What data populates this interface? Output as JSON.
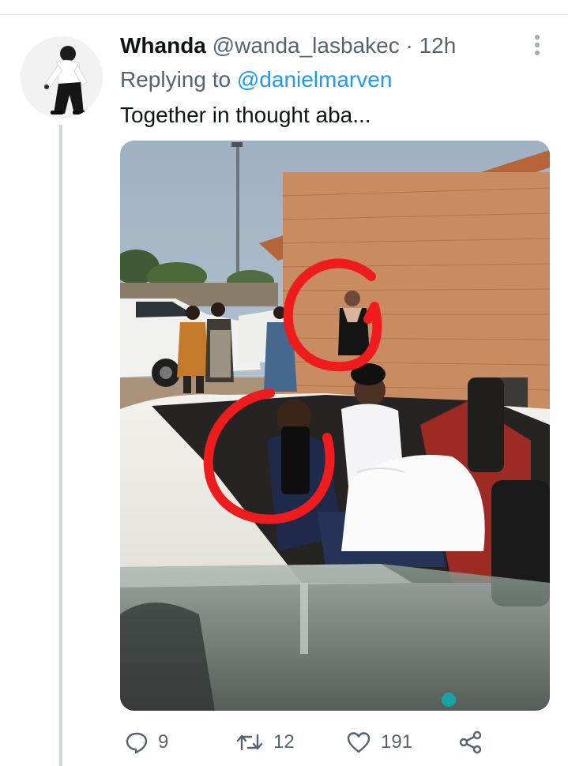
{
  "tweet": {
    "display_name": "Whanda",
    "handle": "@wanda_lasbakec",
    "separator": "·",
    "timestamp": "12h",
    "replying_prefix": "Replying to",
    "replying_to": "@danielmarven",
    "text": "Together in thought aba...",
    "more_icon": "more-vertical-icon"
  },
  "actions": {
    "reply_count": "9",
    "retweet_count": "12",
    "like_count": "191",
    "reply_icon": "reply-bubble-icon",
    "retweet_icon": "retweet-icon",
    "like_icon": "heart-icon",
    "share_icon": "share-icon"
  },
  "colors": {
    "text_primary": "#0f1419",
    "text_secondary": "#536471",
    "link": "#1d9bf0",
    "thread_line": "#cfd9de",
    "annotation_red": "#ee1c1c"
  }
}
